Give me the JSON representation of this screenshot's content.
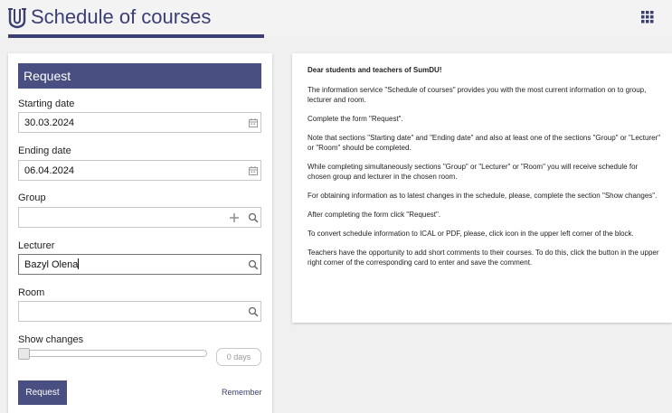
{
  "header": {
    "app_title": "Schedule of courses",
    "logo_icon": "university-logo-icon",
    "apps_icon": "grid-menu-icon",
    "accent_color": "#3b3f72"
  },
  "request": {
    "title": "Request",
    "starting_date": {
      "label": "Starting date",
      "value": "30.03.2024",
      "icon": "calendar-icon"
    },
    "ending_date": {
      "label": "Ending date",
      "value": "06.04.2024",
      "icon": "calendar-icon"
    },
    "group": {
      "label": "Group",
      "value": "",
      "icons": [
        "plus-icon",
        "search-icon"
      ]
    },
    "lecturer": {
      "label": "Lecturer",
      "value": "Bazyl Olena",
      "icon": "search-icon"
    },
    "room": {
      "label": "Room",
      "value": "",
      "icon": "search-icon"
    },
    "show_changes": {
      "label": "Show changes",
      "days_placeholder": "0 days",
      "slider_value": 0
    },
    "request_button": "Request",
    "remember_link": "Remember"
  },
  "info": {
    "greeting": "Dear students and teachers of SumDU!",
    "paragraphs": [
      "The information service \"Schedule of courses\" provides you with the most current information on to group, lecturer and room.",
      "Complete the form \"Request\".",
      "Note that sections \"Starting date\" and \"Ending date\" and also at least one of the sections \"Group\" or \"Lecturer\" or \"Room\" should be completed.",
      "While completing simultaneously sections \"Group\" or \"Lecturer\" or \"Room\" you will receive schedule for chosen group and lecturer in the chosen room.",
      "For obtaining information as to latest changes in the schedule, please, complete the section \"Show changes\".",
      "After completing the form click \"Request\".",
      "To convert schedule information to ICAL or PDF, please, click icon in the upper left corner of the block.",
      "Teachers have the opportunity to add short comments to their courses. To do this, click the button in the upper right corner of the corresponding card to enter and save the comment."
    ]
  }
}
